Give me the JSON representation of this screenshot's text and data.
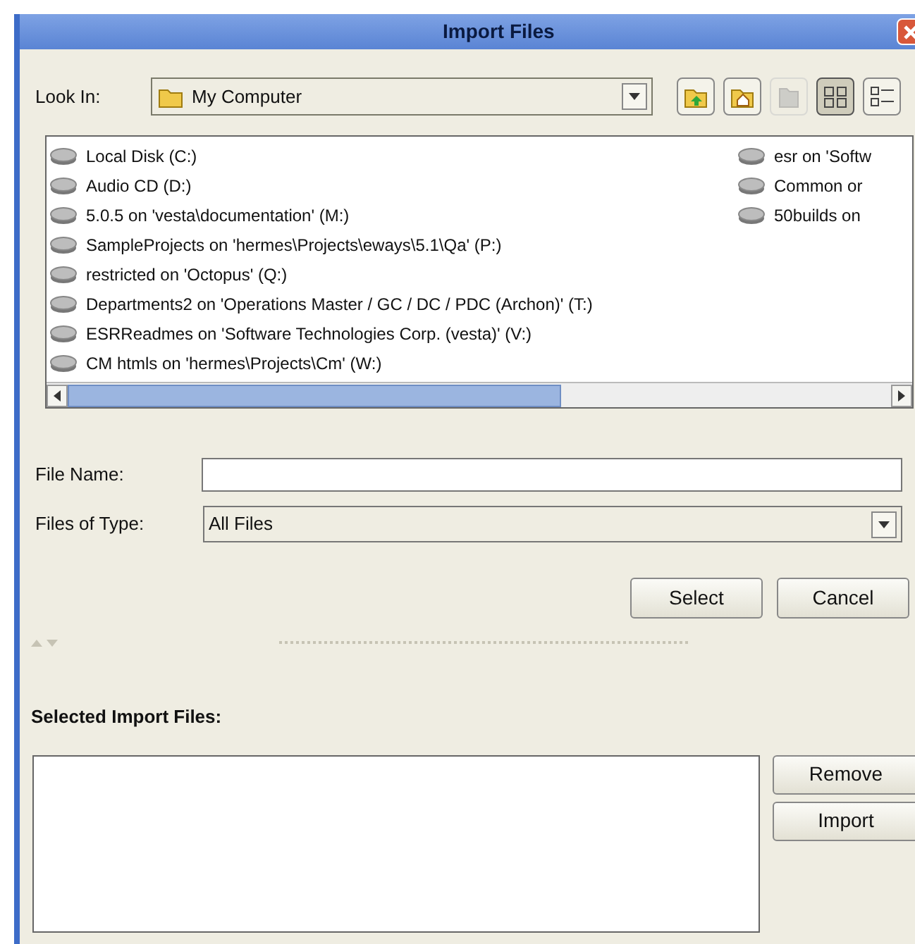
{
  "window": {
    "title": "Import Files"
  },
  "look_in": {
    "label": "Look In:",
    "value": "My Computer"
  },
  "toolbar": [
    {
      "kind": "up",
      "disabled": false
    },
    {
      "kind": "home",
      "disabled": false
    },
    {
      "kind": "new_folder",
      "disabled": true
    },
    {
      "kind": "list_view",
      "selected": true
    },
    {
      "kind": "details_view",
      "selected": false
    }
  ],
  "file_list": {
    "columns": [
      [
        {
          "name": "Local Disk (C:)"
        },
        {
          "name": "Audio CD (D:)"
        },
        {
          "name": "5.0.5 on 'vesta\\documentation' (M:)"
        },
        {
          "name": "SampleProjects on 'hermes\\Projects\\eways\\5.1\\Qa' (P:)"
        },
        {
          "name": "restricted on 'Octopus' (Q:)"
        },
        {
          "name": "Departments2 on 'Operations Master / GC / DC / PDC (Archon)' (T:)"
        },
        {
          "name": "ESRReadmes on 'Software Technologies Corp. (vesta)' (V:)"
        },
        {
          "name": "CM htmls on 'hermes\\Projects\\Cm' (W:)"
        }
      ],
      [
        {
          "name": "esr on 'Softw"
        },
        {
          "name": "Common or"
        },
        {
          "name": "50builds on"
        }
      ]
    ]
  },
  "file_name": {
    "label": "File Name:"
  },
  "file_type": {
    "label": "Files of Type:",
    "value": "All Files"
  },
  "buttons": [
    "Select",
    "Cancel"
  ],
  "selected_files": {
    "label": "Selected Import Files:",
    "buttons": [
      "Remove",
      "Import"
    ]
  }
}
